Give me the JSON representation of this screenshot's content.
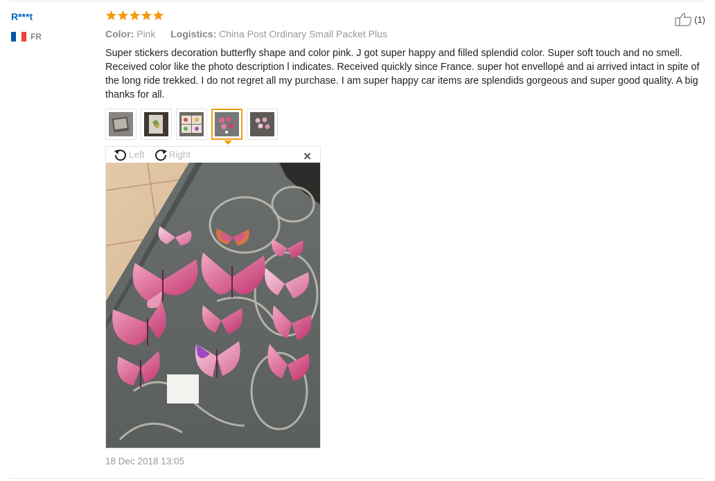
{
  "reviewer": {
    "name": "R***t",
    "country_code": "FR",
    "flag_colors": [
      "#0055a4",
      "#ffffff",
      "#ef4135"
    ]
  },
  "rating": {
    "stars": 5,
    "max": 5,
    "color": "#f39c12"
  },
  "meta": {
    "color_label": "Color:",
    "color_value": "Pink",
    "logistics_label": "Logistics:",
    "logistics_value": "China Post Ordinary Small Packet Plus"
  },
  "helpful": {
    "icon": "thumbs-up-icon",
    "count": "(1)"
  },
  "review_text": "Super stickers decoration butterfly shape and color pink. J got super happy and filled splendid color. Super soft touch and no smell. Received color like the photo description l indicates. Received quickly since France. super hot envellopé and ai arrived intact in spite of the long ride trekked. I do not regret all my purchase. I am super happy car items are splendids gorgeous and super good quality. A big thanks for all.",
  "thumbnails": [
    {
      "name": "review-photo-1",
      "active": false
    },
    {
      "name": "review-photo-2",
      "active": false
    },
    {
      "name": "review-photo-3",
      "active": false
    },
    {
      "name": "review-photo-4",
      "active": true
    },
    {
      "name": "review-photo-5",
      "active": false
    }
  ],
  "viewer": {
    "rotate_left_label": "Left",
    "rotate_right_label": "Right",
    "close_icon": "close-icon"
  },
  "date": "18 Dec 2018 13:05",
  "accent_color": "#f39c12",
  "link_color": "#0066c0"
}
